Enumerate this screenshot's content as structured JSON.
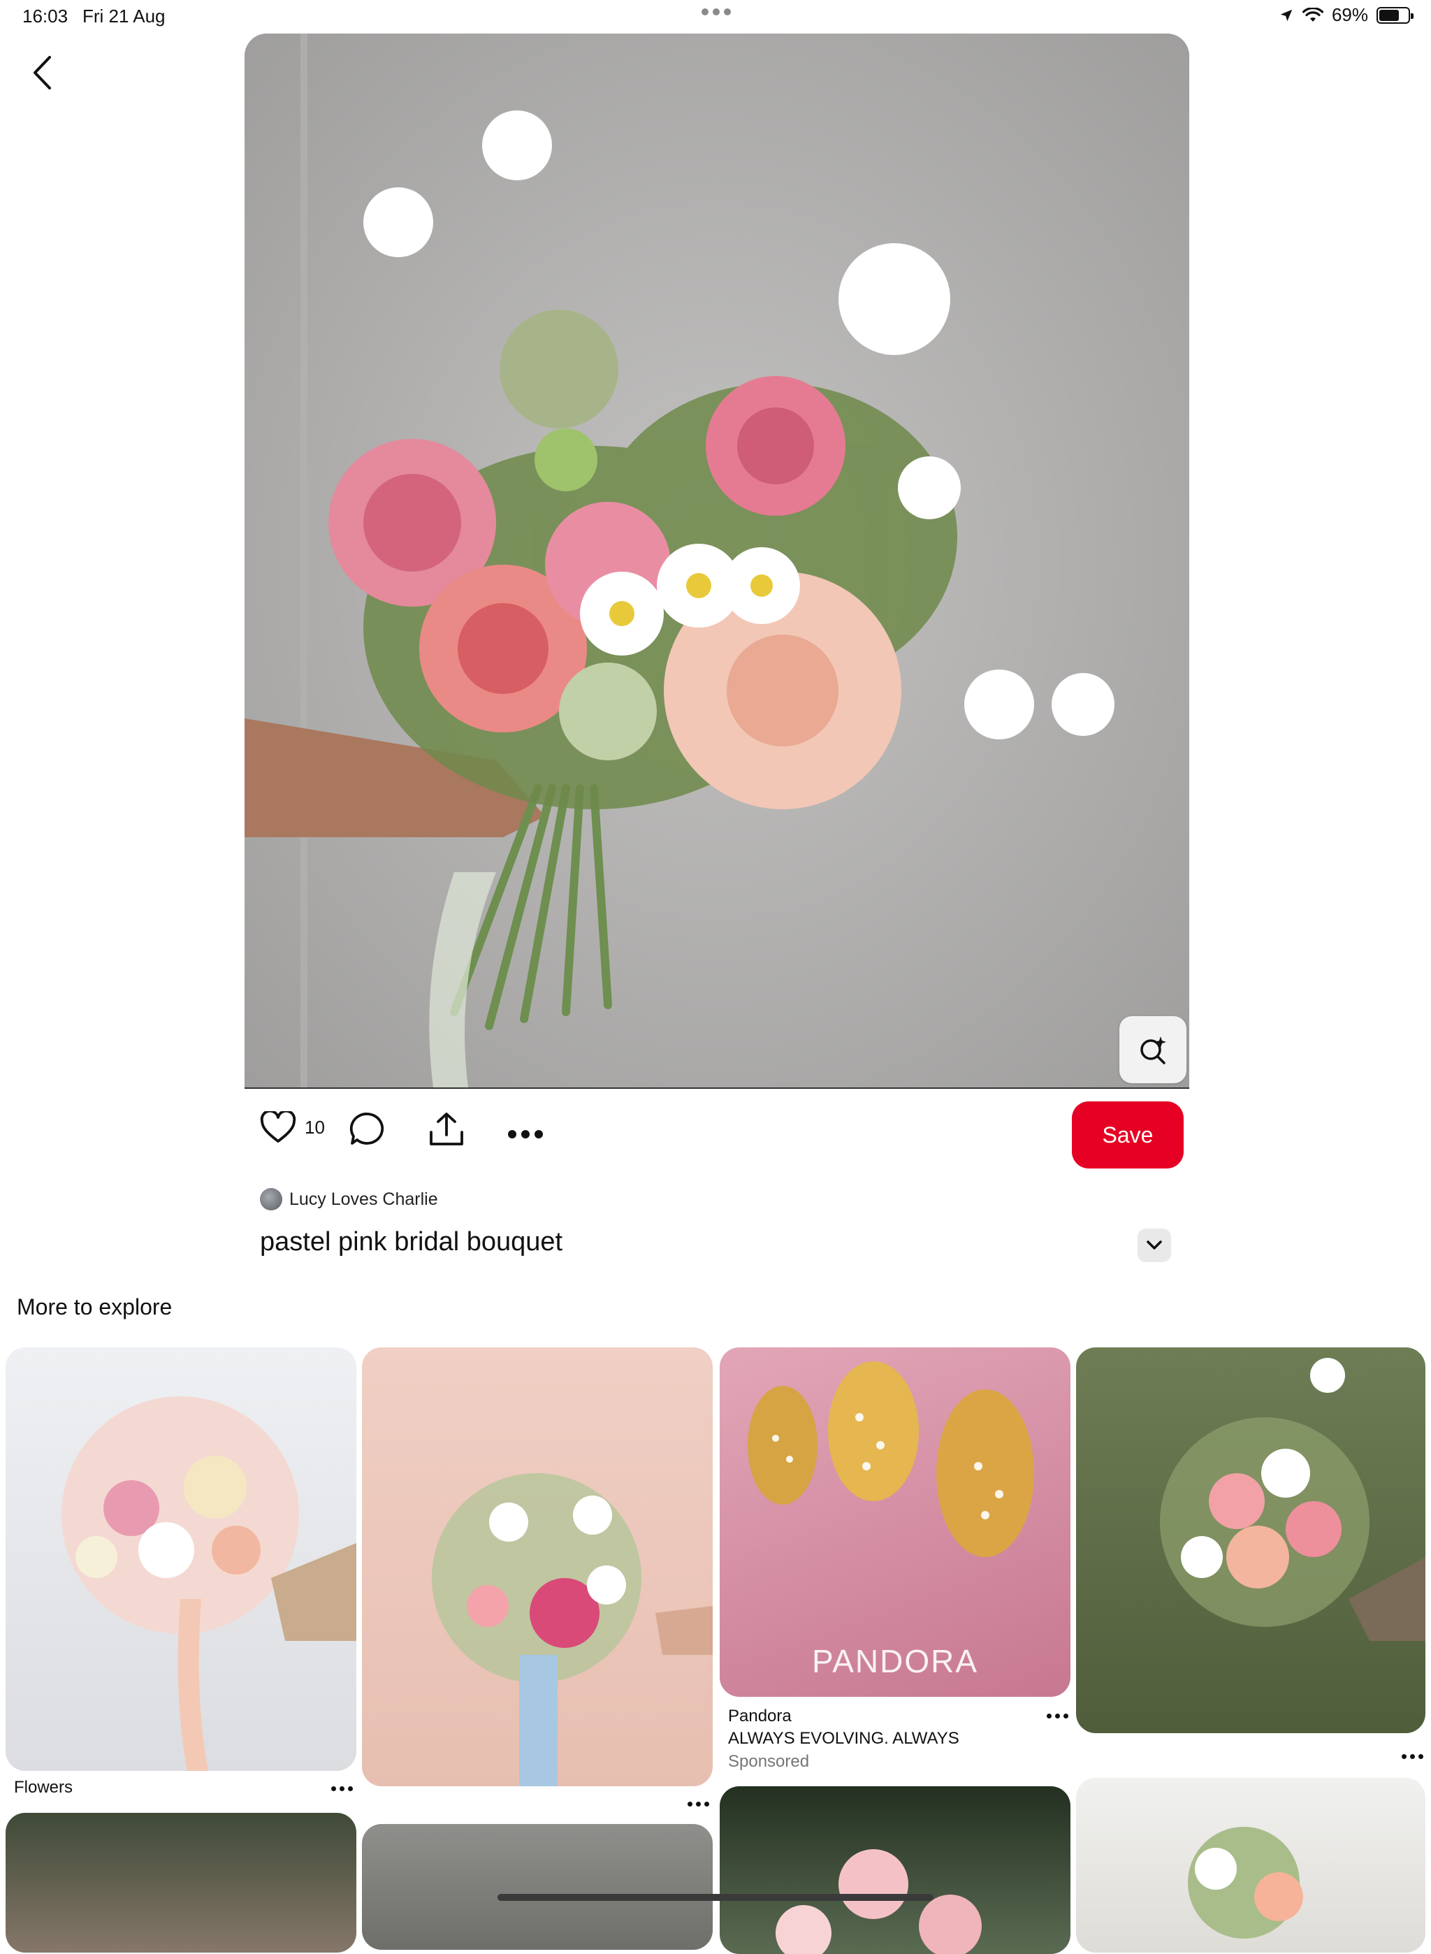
{
  "status_bar": {
    "time": "16:03",
    "date": "Fri 21 Aug",
    "battery": "69%",
    "battery_level": 0.69
  },
  "pin": {
    "like_count": "10",
    "save_label": "Save",
    "creator": "Lucy Loves Charlie",
    "title": "pastel pink bridal bouquet"
  },
  "explore": {
    "heading": "More to explore",
    "tiles": [
      {
        "caption": "Flowers"
      },
      {
        "caption": ""
      },
      {
        "brand": "PANDORA",
        "advertiser": "Pandora",
        "tagline": "ALWAYS EVOLVING. ALWAYS",
        "sponsored": "Sponsored"
      },
      {
        "caption": ""
      }
    ]
  },
  "colors": {
    "save_button": "#e60023",
    "background": "#ffffff"
  }
}
